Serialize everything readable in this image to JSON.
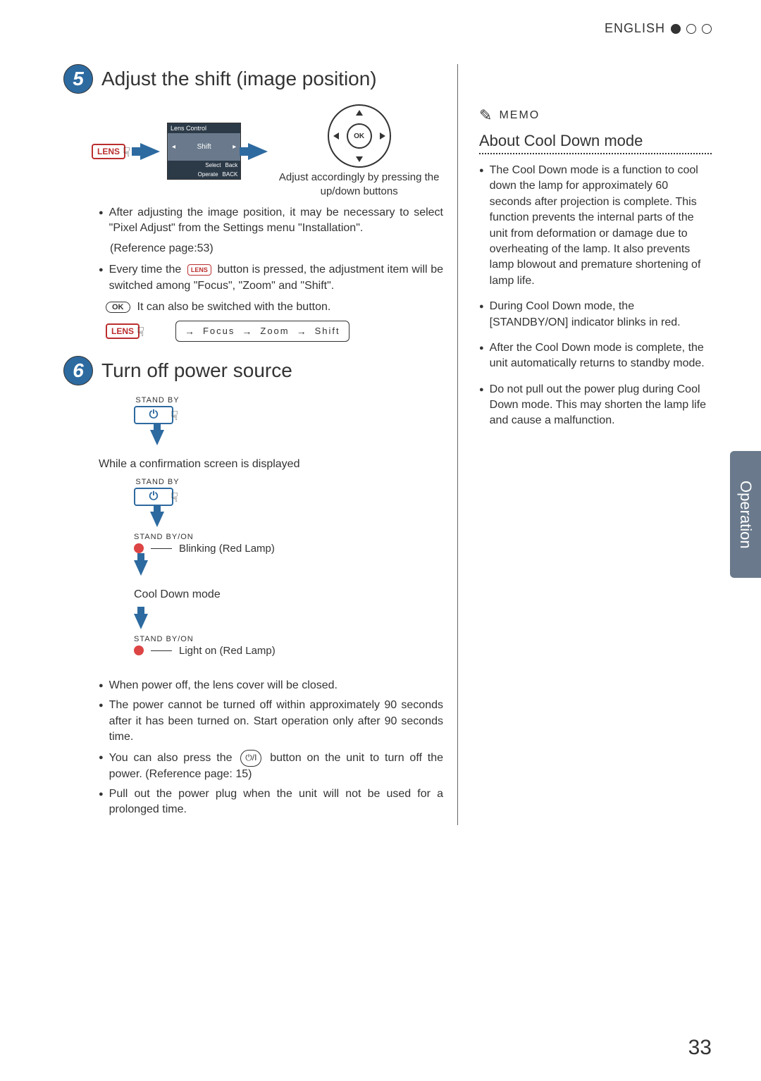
{
  "header": {
    "language": "ENGLISH"
  },
  "sideTab": "Operation",
  "pageNumber": "33",
  "section5": {
    "number": "5",
    "title": "Adjust the shift (image position)",
    "lensLabel": "LENS",
    "osd": {
      "title": "Lens Control",
      "item": "Shift",
      "footSelect": "Select",
      "footBack": "Back",
      "footOperate": "Operate",
      "footBack2": "BACK"
    },
    "okLabel": "OK",
    "caption": "Adjust accordingly by pressing the up/down buttons",
    "bullet1": "After adjusting the image position, it may be necessary to select \"Pixel Adjust\" from the Settings menu \"Installation\".",
    "ref": "(Reference page:53)",
    "bullet2a": "Every time the ",
    "bullet2b": " button is pressed, the adjustment item will be switched among \"Focus\", \"Zoom\" and \"Shift\".",
    "okNote": "It can also be switched with the button.",
    "cycle": {
      "a": "Focus",
      "b": "Zoom",
      "c": "Shift"
    }
  },
  "section6": {
    "number": "6",
    "title": "Turn off power source",
    "standby": "STAND BY",
    "confirm": "While a confirmation screen is displayed",
    "indicator": "STAND BY/ON",
    "blink": "Blinking (Red Lamp)",
    "cooldown": "Cool Down mode",
    "lighton": "Light on (Red Lamp)",
    "b1": "When power off, the lens cover will be closed.",
    "b2": "The power cannot be turned off within approximately 90 seconds after it has been turned on. Start operation only after 90 seconds time.",
    "b3a": "You can also press the ",
    "b3b": " button on the unit to turn off the power. (Reference page: 15)",
    "b4": "Pull out the power plug when the unit will not be used for a prolonged time."
  },
  "memo": {
    "label": "MEMO",
    "title": "About Cool Down mode",
    "b1": "The Cool Down mode is a function to cool down the lamp for approximately 60 seconds after projection is complete. This function prevents the internal parts of the unit from deformation or damage due to overheating of the lamp. It also prevents lamp blowout and premature shortening of lamp life.",
    "b2": "During Cool Down mode, the [STANDBY/ON] indicator blinks in red.",
    "b3": "After the Cool Down mode is complete, the unit automatically returns to standby mode.",
    "b4": "Do not pull out the power plug during Cool Down mode. This may shorten the lamp life and cause a malfunction."
  }
}
